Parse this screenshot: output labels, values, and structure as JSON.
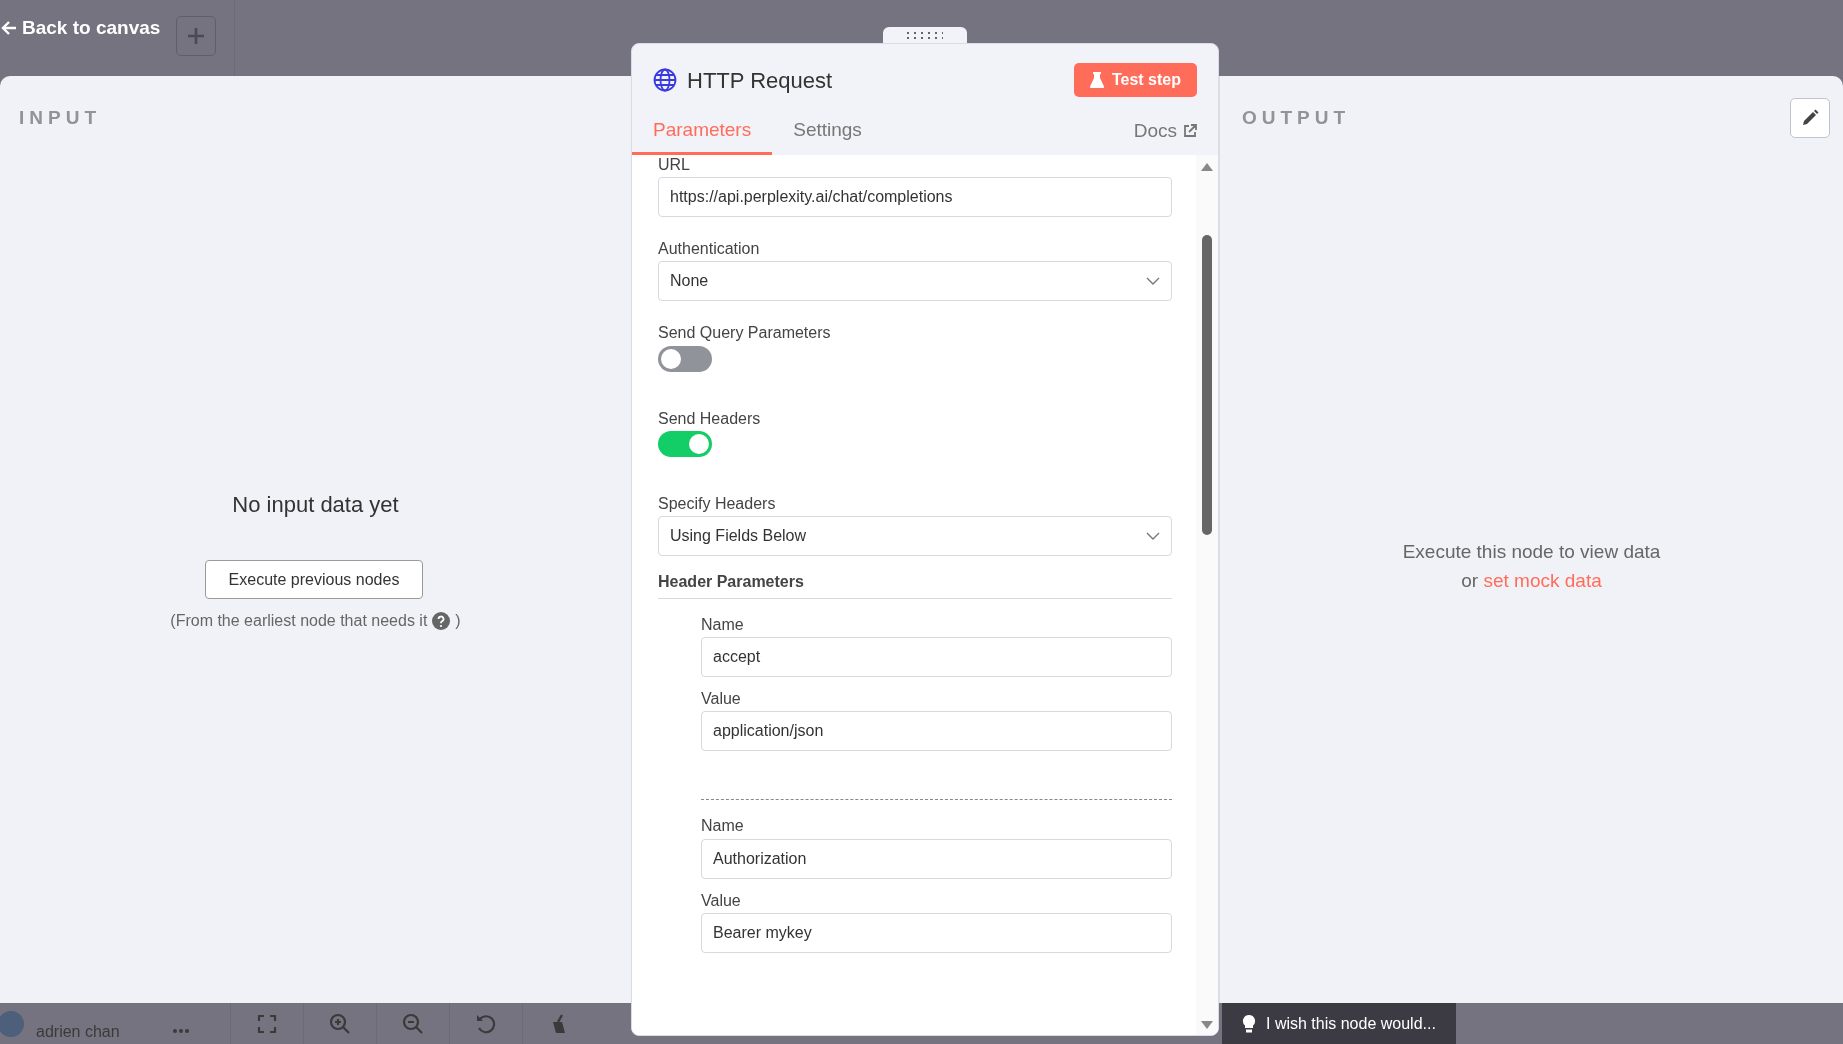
{
  "top_bar": {
    "back_label": "Back to canvas"
  },
  "input_panel": {
    "heading": "INPUT",
    "empty_title": "No input data yet",
    "button": "Execute previous nodes",
    "hint": "(From the earliest node that needs it",
    "hint_close": ")"
  },
  "node": {
    "title": "HTTP Request",
    "test_button": "Test step",
    "tabs": [
      {
        "label": "Parameters",
        "selected": true
      },
      {
        "label": "Settings",
        "selected": false
      }
    ],
    "docs_link": "Docs",
    "fields": [
      {
        "kind": "text",
        "label": "URL",
        "value": "https://api.perplexity.ai/chat/completions"
      },
      {
        "kind": "select",
        "label": "Authentication",
        "value": "None"
      },
      {
        "kind": "toggle",
        "label": "Send Query Parameters",
        "on": false
      },
      {
        "kind": "toggle",
        "label": "Send Headers",
        "on": true
      },
      {
        "kind": "select",
        "label": "Specify Headers",
        "value": "Using Fields Below"
      }
    ],
    "header_parameters": {
      "title": "Header Parameters",
      "entries": [
        {
          "name_label": "Name",
          "name": "accept",
          "value_label": "Value",
          "value": "application/json"
        },
        {
          "name_label": "Name",
          "name": "Authorization",
          "value_label": "Value",
          "value": "Bearer mykey"
        }
      ]
    }
  },
  "output_panel": {
    "heading": "OUTPUT",
    "message": "Execute this node to view data",
    "prefix": "or",
    "link": "set mock data"
  },
  "bottom_bar": {
    "user": "adrien chan",
    "feedback": "I wish this node would..."
  }
}
